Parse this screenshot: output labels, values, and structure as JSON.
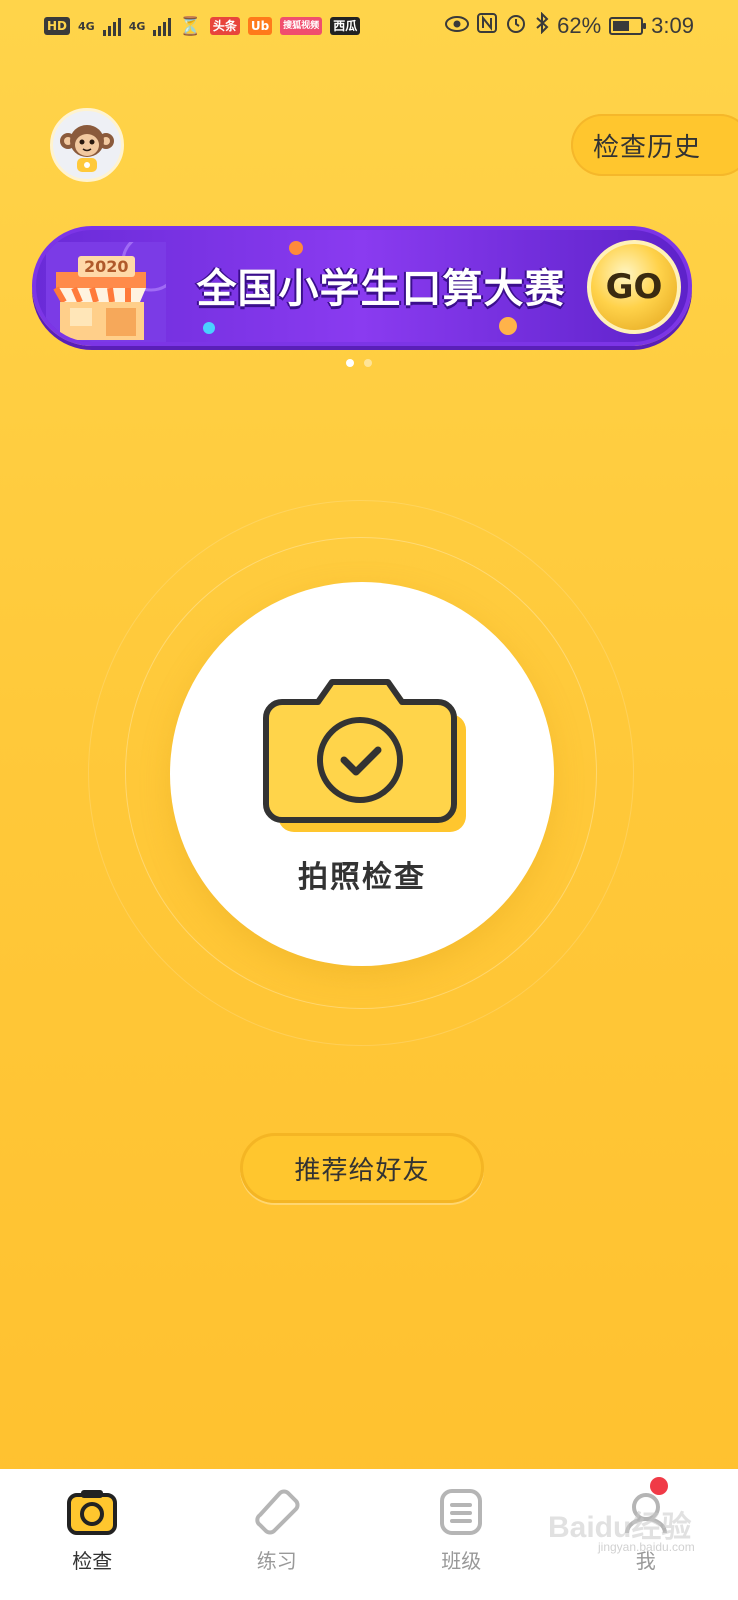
{
  "status_bar": {
    "left_chips": [
      "HD",
      "头条",
      "Ub",
      "搜狐视频",
      "西瓜"
    ],
    "network_1": "4G",
    "network_2": "4G",
    "battery_pct": "62%",
    "time": "3:09"
  },
  "header": {
    "history_label": "检查历史"
  },
  "banner": {
    "year": "2020",
    "title": "全国小学生口算大赛",
    "go_label": "GO",
    "page_count": 2,
    "active_page": 1
  },
  "capture": {
    "label": "拍照检查"
  },
  "recommend": {
    "label": "推荐给好友"
  },
  "bottom_nav": {
    "items": [
      {
        "label": "检查",
        "icon": "camera-icon",
        "active": true
      },
      {
        "label": "练习",
        "icon": "tag-icon",
        "active": false
      },
      {
        "label": "班级",
        "icon": "list-icon",
        "active": false
      },
      {
        "label": "我",
        "icon": "profile-icon",
        "active": false
      }
    ]
  },
  "watermark": {
    "text": "Baidu经验",
    "sub": "jingyan.baidu.com"
  },
  "colors": {
    "background": "#FFC93A",
    "banner_purple": "#7c35e6",
    "notification_red": "#f03a47"
  }
}
